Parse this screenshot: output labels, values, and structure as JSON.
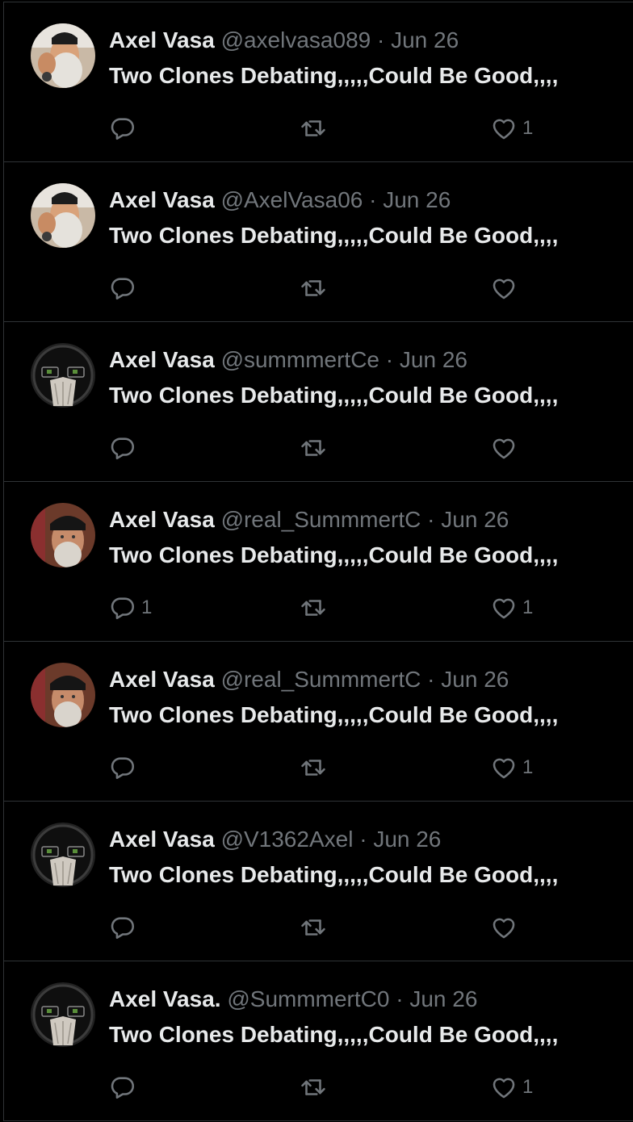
{
  "tweets": [
    {
      "name": "Axel Vasa",
      "handle": "@axelvasa089",
      "date": "Jun 26",
      "text": "Two Clones Debating,,,,,Could Be Good,,,,",
      "avatar": "avatar-hand-icon",
      "replies": "",
      "likes": "1"
    },
    {
      "name": "Axel Vasa",
      "handle": "@AxelVasa06",
      "date": "Jun 26",
      "text": "Two Clones Debating,,,,,Could Be Good,,,,",
      "avatar": "avatar-hand-icon",
      "replies": "",
      "likes": ""
    },
    {
      "name": "Axel Vasa",
      "handle": "@summmertCe",
      "date": "Jun 26",
      "text": "Two Clones Debating,,,,,Could Be Good,,,,",
      "avatar": "avatar-glasses-icon",
      "replies": "",
      "likes": ""
    },
    {
      "name": "Axel Vasa",
      "handle": "@real_SummmertC",
      "date": "Jun 26",
      "text": "Two Clones Debating,,,,,Could Be Good,,,,",
      "avatar": "avatar-portrait-icon",
      "replies": "1",
      "likes": "1"
    },
    {
      "name": "Axel Vasa",
      "handle": "@real_SummmertC",
      "date": "Jun 26",
      "text": "Two Clones Debating,,,,,Could Be Good,,,,",
      "avatar": "avatar-portrait-icon",
      "replies": "",
      "likes": "1"
    },
    {
      "name": "Axel Vasa",
      "handle": "@V1362Axel",
      "date": "Jun 26",
      "text": "Two Clones Debating,,,,,Could Be Good,,,,",
      "avatar": "avatar-glasses-icon",
      "replies": "",
      "likes": ""
    },
    {
      "name": "Axel Vasa.",
      "handle": "@SummmertC0",
      "date": "Jun 26",
      "text": "Two Clones Debating,,,,,Could Be Good,,,,",
      "avatar": "avatar-glasses-icon",
      "replies": "",
      "likes": "1"
    }
  ],
  "separator": "·",
  "colors": {
    "background": "#000000",
    "text": "#e7e9ea",
    "secondary": "#71767b",
    "border": "#2f3336"
  }
}
